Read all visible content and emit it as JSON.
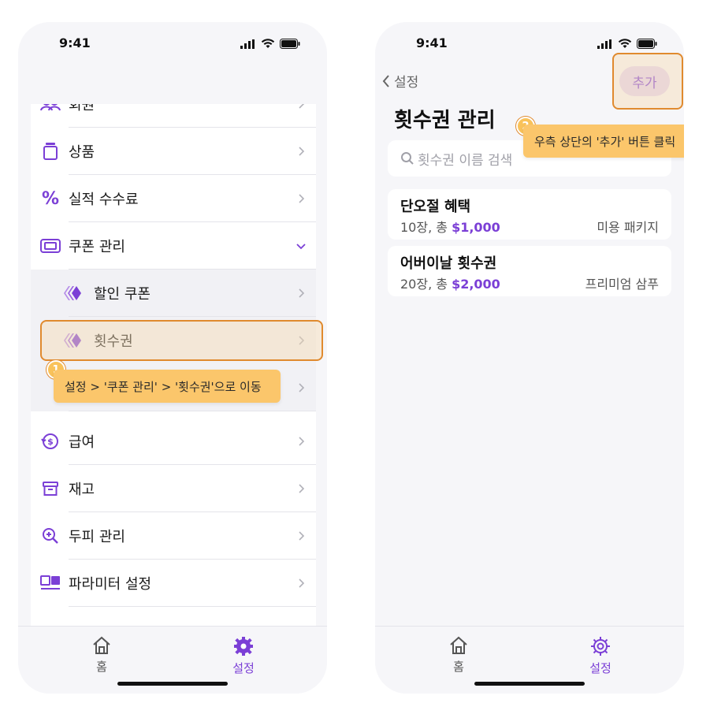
{
  "status_time": "9:41",
  "left_screen": {
    "menu_items": [
      {
        "label": "회원",
        "icon": "member-icon"
      },
      {
        "label": "상품",
        "icon": "product-icon"
      },
      {
        "label": "실적 수수료",
        "icon": "percent-icon"
      },
      {
        "label": "쿠폰 관리",
        "icon": "coupon-icon",
        "expanded": true
      },
      {
        "label": "할인 쿠폰",
        "icon": "diamond-icon",
        "sub": true
      },
      {
        "label": "횟수권",
        "icon": "diamond-icon",
        "sub": true,
        "highlighted": true
      },
      {
        "label": "급여",
        "icon": "salary-icon"
      },
      {
        "label": "재고",
        "icon": "inventory-icon"
      },
      {
        "label": "두피 관리",
        "icon": "scalp-icon"
      },
      {
        "label": "파라미터 설정",
        "icon": "parameter-icon"
      }
    ],
    "step1_number": "1",
    "step1_tooltip": "설정 > '쿠폰 관리' > '횟수권'으로 이동",
    "tabs": [
      {
        "label": "홈",
        "icon": "home-icon"
      },
      {
        "label": "설정",
        "icon": "gear-icon",
        "active": true
      }
    ]
  },
  "right_screen": {
    "back_label": "설정",
    "add_label": "추가",
    "title": "횟수권 관리",
    "search_placeholder": "횟수권 이름 검색",
    "step2_number": "2",
    "step2_tooltip": "우측 상단의 '추가' 버튼 클릭",
    "tickets": [
      {
        "name": "단오절 혜택",
        "count": "10장, 총 ",
        "price": "$1,000",
        "service": "미용 패키지"
      },
      {
        "name": "어버이날 횟수권",
        "count": "20장, 총 ",
        "price": "$2,000",
        "service": "프리미엄 삼푸"
      }
    ],
    "tabs": [
      {
        "label": "홈",
        "icon": "home-icon"
      },
      {
        "label": "설정",
        "icon": "gear-icon",
        "active": true
      }
    ]
  },
  "colors": {
    "accent": "#7b3fd6",
    "highlight": "#e08a2e",
    "tooltip": "#fbc66b"
  }
}
